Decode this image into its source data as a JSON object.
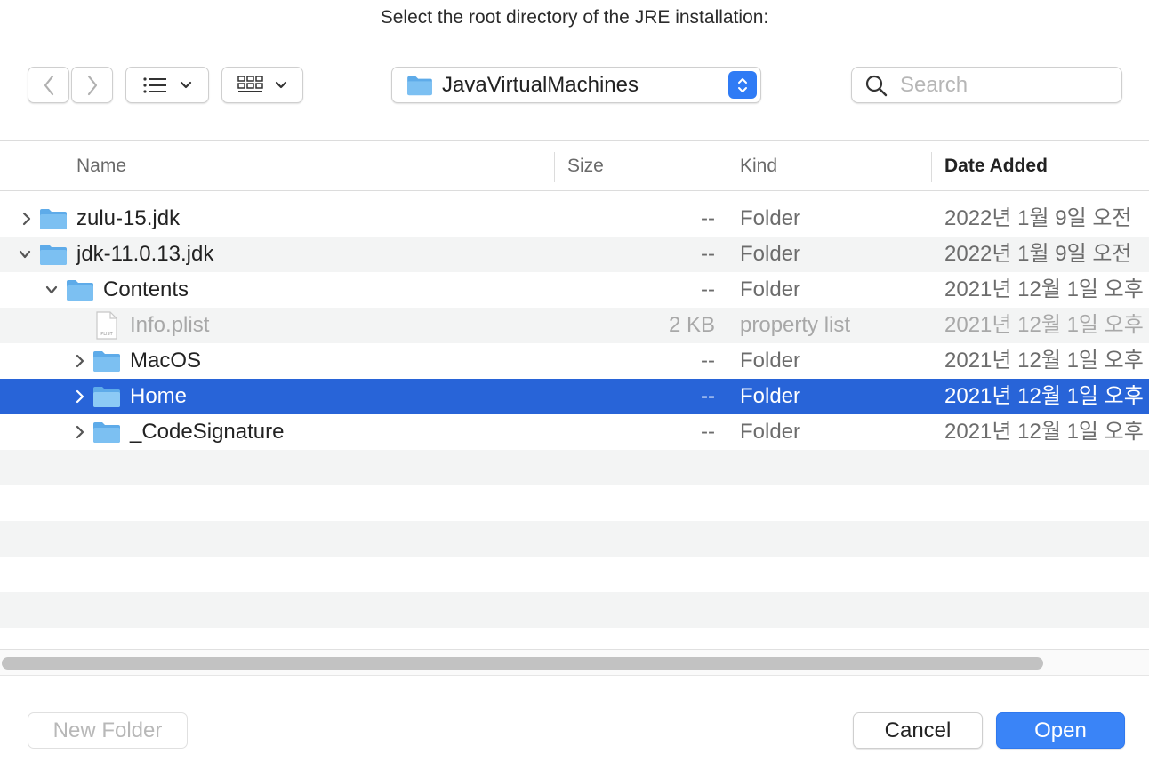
{
  "dialog": {
    "title": "Select the root directory of the JRE installation:"
  },
  "toolbar": {
    "path_label": "JavaVirtualMachines",
    "search_placeholder": "Search"
  },
  "columns": {
    "name": "Name",
    "size": "Size",
    "kind": "Kind",
    "date_added": "Date Added"
  },
  "rows": [
    {
      "name": "zulu-15.jdk",
      "size": "--",
      "kind": "Folder",
      "date": "2022년 1월 9일 오전",
      "expanded": false,
      "selected": false,
      "type": "folder"
    },
    {
      "name": "jdk-11.0.13.jdk",
      "size": "--",
      "kind": "Folder",
      "date": "2022년 1월 9일 오전",
      "expanded": true,
      "selected": false,
      "type": "folder"
    },
    {
      "name": "Contents",
      "size": "--",
      "kind": "Folder",
      "date": "2021년 12월 1일 오후",
      "expanded": true,
      "selected": false,
      "type": "folder"
    },
    {
      "name": "Info.plist",
      "size": "2 KB",
      "kind": "property list",
      "date": "2021년 12월 1일 오후",
      "expanded": false,
      "selected": false,
      "type": "file",
      "disabled": true,
      "icon_label": "PLIST"
    },
    {
      "name": "MacOS",
      "size": "--",
      "kind": "Folder",
      "date": "2021년 12월 1일 오후",
      "expanded": false,
      "selected": false,
      "type": "folder"
    },
    {
      "name": "Home",
      "size": "--",
      "kind": "Folder",
      "date": "2021년 12월 1일 오후",
      "expanded": false,
      "selected": true,
      "type": "folder"
    },
    {
      "name": "_CodeSignature",
      "size": "--",
      "kind": "Folder",
      "date": "2021년 12월 1일 오후",
      "expanded": false,
      "selected": false,
      "type": "folder"
    }
  ],
  "footer": {
    "new_folder_label": "New Folder",
    "cancel_label": "Cancel",
    "open_label": "Open"
  },
  "colors": {
    "accent": "#3a84f7",
    "selection": "#2864d8",
    "folder": "#5eabe9"
  }
}
